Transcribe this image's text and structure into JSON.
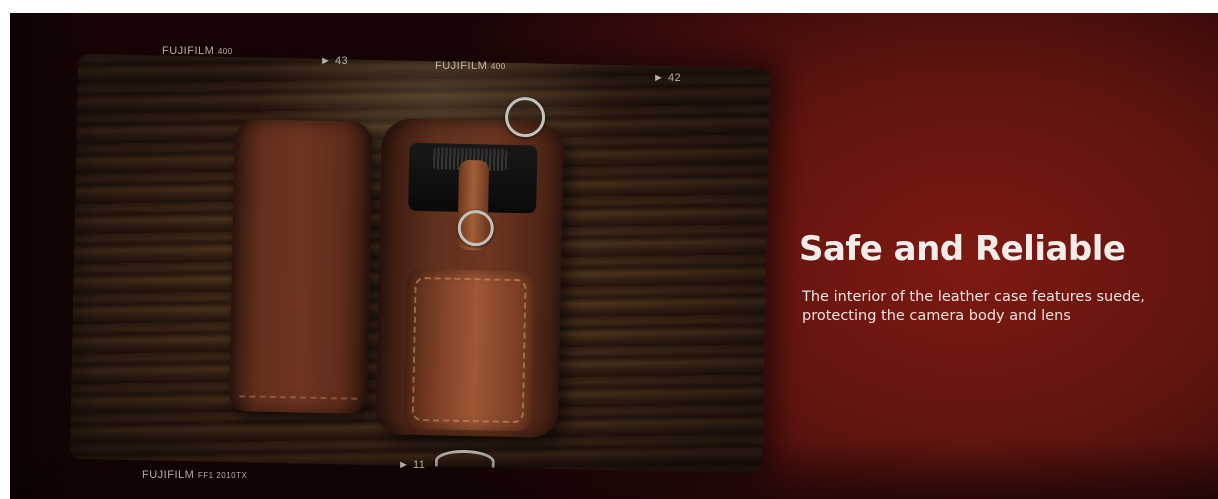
{
  "banner": {
    "headline": "Safe and Reliable",
    "description": "The interior of the leather case features suede, protecting the camera body and lens",
    "background_color": "#5f140e",
    "accent_color": "#7d1a12"
  },
  "film_strip": {
    "marks": [
      {
        "brand": "FUJIFILM",
        "code": "400"
      },
      {
        "frame": "► 43"
      },
      {
        "brand": "FUJIFILM",
        "code": "400"
      },
      {
        "frame": "► 42"
      },
      {
        "brand": "FUJIFILM",
        "code": "FF1 2010TX"
      },
      {
        "frame": "► 11"
      }
    ]
  },
  "photo": {
    "subject": "leather-camera-case"
  }
}
